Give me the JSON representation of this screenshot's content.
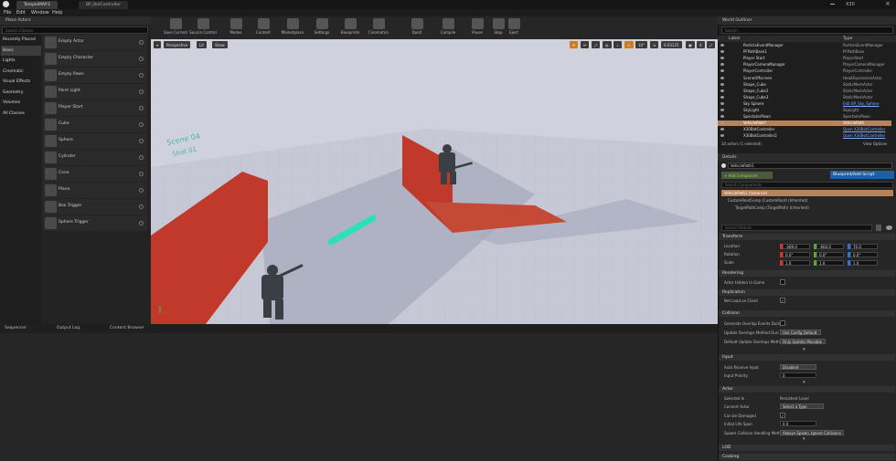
{
  "window": {
    "tabs": [
      "TempleMAP.1",
      "BP_BotController"
    ],
    "fps": "X30",
    "menu": [
      "File",
      "Edit",
      "Window",
      "Help"
    ]
  },
  "modes": {
    "panel_title": "Place Actors",
    "search_placeholder": "Search Classes",
    "categories": [
      "Recently Placed",
      "Basic",
      "Lights",
      "Cinematic",
      "Visual Effects",
      "Geometry",
      "Volumes",
      "All Classes"
    ],
    "actors": [
      "Empty Actor",
      "Empty Character",
      "Empty Pawn",
      "Point Light",
      "Player Start",
      "Cube",
      "Sphere",
      "Cylinder",
      "Cone",
      "Plane",
      "Box Trigger",
      "Sphere Trigger"
    ]
  },
  "toolbar": {
    "items": [
      "Save Current",
      "Source Control",
      "Modes",
      "Content",
      "Marketplace",
      "Settings",
      "Blueprints",
      "Cinematics",
      "Build",
      "Compile",
      "Pause",
      "Stop",
      "Eject"
    ]
  },
  "viewport": {
    "perspective": "Perspective",
    "lit": "Lit",
    "show": "Show",
    "snap_angle": "10°",
    "snap_scale": "0.03125",
    "grid_count": "4",
    "scene_text_1": "Scene 04",
    "scene_text_2": "Shot 01"
  },
  "bottom_tabs": [
    "Sequencer",
    "Output Log",
    "Content Browser"
  ],
  "outliner": {
    "title": "World Outliner",
    "search_placeholder": "Search...",
    "col_label": "Label",
    "col_type": "Type",
    "rows": [
      {
        "label": "ParticleEventManager",
        "type": "ParticleEventManager"
      },
      {
        "label": "PFPathBase1",
        "type": "PFPathBase"
      },
      {
        "label": "Player Start",
        "type": "PlayerStart"
      },
      {
        "label": "PlayerCameraManager",
        "type": "PlayerCameraManager"
      },
      {
        "label": "PlayerController",
        "type": "PlayerController"
      },
      {
        "label": "SceneOffscreen",
        "type": "HeadExpressionActor"
      },
      {
        "label": "Shape_Cube",
        "type": "StaticMeshActor"
      },
      {
        "label": "Shape_Cube2",
        "type": "StaticMeshActor"
      },
      {
        "label": "Shape_Cube3",
        "type": "StaticMeshActor"
      },
      {
        "label": "Sky Sphere",
        "type": "Edit BP_Sky_Sphere"
      },
      {
        "label": "SkyLight",
        "type": "SkyLight"
      },
      {
        "label": "SpectatorPawn",
        "type": "SpectatorPawn"
      },
      {
        "label": "VehiclePath*",
        "type": "VehiclePath"
      },
      {
        "label": "X30BotController",
        "type": "Open X30BotController"
      },
      {
        "label": "X30BotController2",
        "type": "Open X30BotController"
      }
    ],
    "footer_count": "34 actors (1 selected)",
    "view_options": "View Options"
  },
  "details": {
    "title": "Details",
    "name_value": "VehiclePath1",
    "add_component": "+ Add Component",
    "blueprint_button": "Blueprint/Add Script",
    "search_components": "Search Components",
    "components": [
      "VehiclePath1 (Instance)",
      "CustomRootComp (CustomRoot) (Inherited)",
      "TargetPathComp (TargetPath) (Inherited)"
    ],
    "search_details": "Search Details",
    "transform": {
      "title": "Transform",
      "location_label": "Location",
      "location": [
        "-269.0",
        "-604.0",
        "70.0"
      ],
      "rotation_label": "Rotation",
      "rotation": [
        "0.0°",
        "0.0°",
        "0.0°"
      ],
      "scale_label": "Scale",
      "scale": [
        "1.0",
        "1.0",
        "1.0"
      ]
    },
    "rendering": {
      "title": "Rendering",
      "hidden_label": "Actor Hidden In Game"
    },
    "replication": {
      "title": "Replication",
      "net_load_label": "Net Load on Client"
    },
    "collision": {
      "title": "Collision",
      "gen_overlap_label": "Generate Overlap Events During...",
      "update_method_label": "Update Overlaps Method Duri...",
      "update_method_value": "Use Config Default",
      "default_update_label": "Default Update Overlaps Meth...",
      "default_update_value": "Only Update Movable"
    },
    "input": {
      "title": "Input",
      "auto_receive_label": "Auto Receive Input",
      "auto_receive_value": "Disabled",
      "priority_label": "Input Priority",
      "priority_value": "0"
    },
    "actor": {
      "title": "Actor",
      "selected_in_label": "Selected In",
      "selected_in_value": "Persistent Level",
      "convert_label": "Convert Actor",
      "convert_value": "Select a Type",
      "damaged_label": "Can be Damaged",
      "lifespan_label": "Initial Life Span",
      "lifespan_value": "0.0",
      "spawn_label": "Spawn Collision Handling Meth...",
      "spawn_value": "Always Spawn, Ignore Collisions"
    },
    "lod_title": "LOD",
    "cooking_title": "Cooking"
  },
  "colors": {
    "selection": "#b9835a",
    "wall_red": "#c0392b",
    "blueprint_blue": "#1f5fa8",
    "floor": "#c8cbd6"
  }
}
